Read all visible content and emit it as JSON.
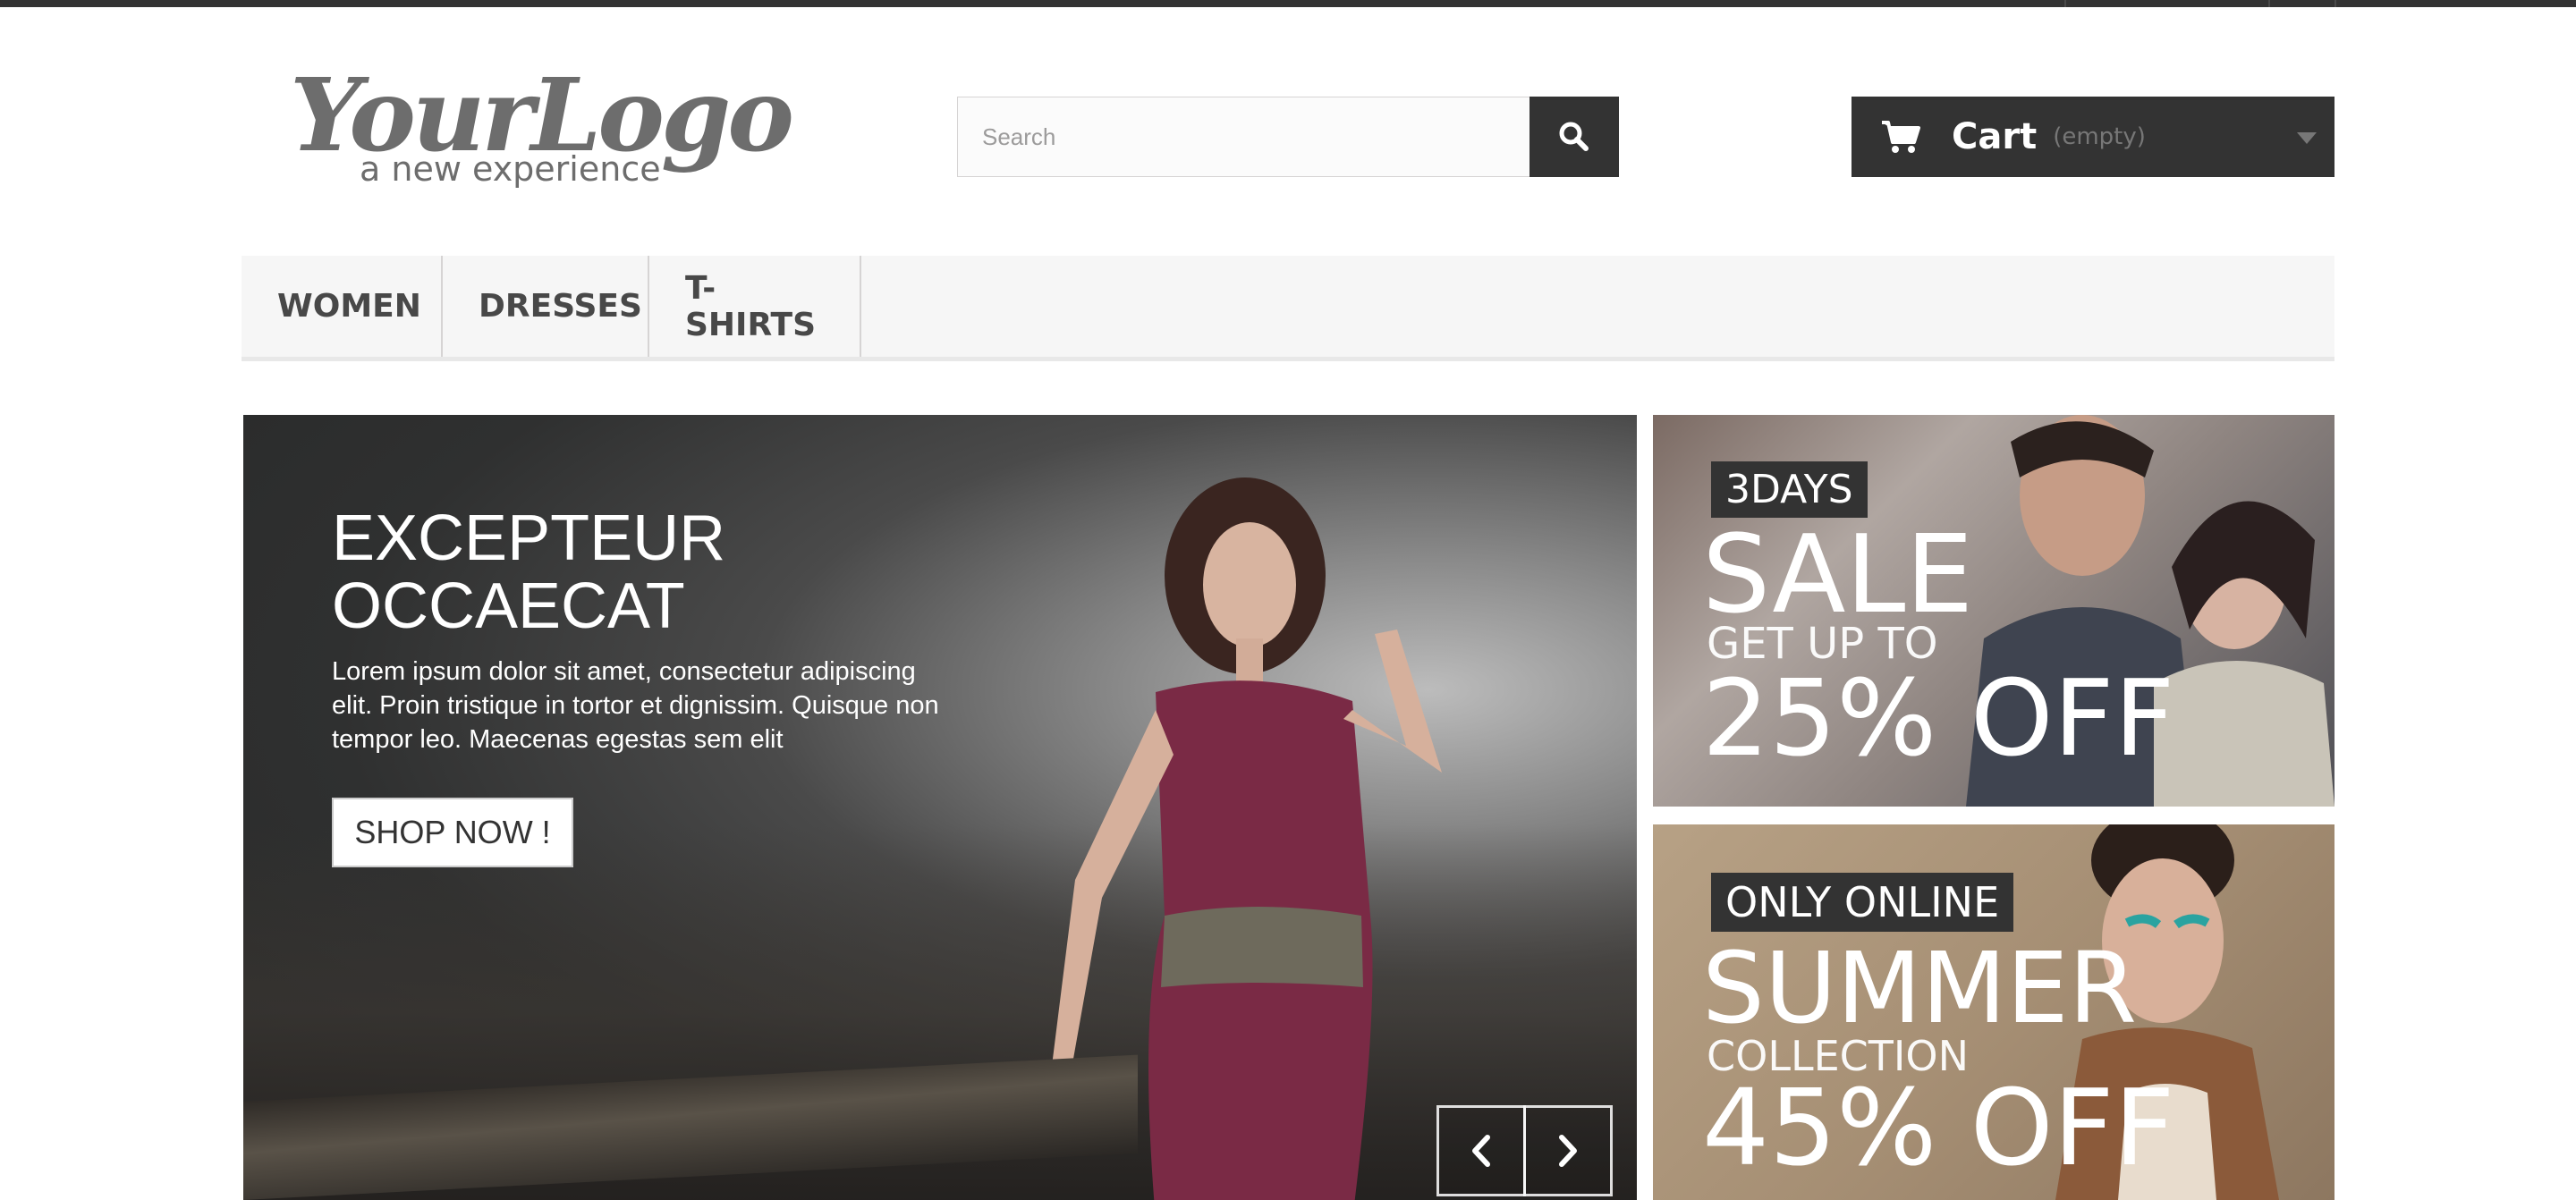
{
  "logo": {
    "main": "YourLogo",
    "tagline": "a new experience"
  },
  "search": {
    "placeholder": "Search"
  },
  "cart": {
    "label": "Cart",
    "state": "(empty)"
  },
  "menu": {
    "items": [
      {
        "label": "WOMEN"
      },
      {
        "label": "DRESSES"
      },
      {
        "label": "T-SHIRTS"
      }
    ]
  },
  "slider": {
    "title": "EXCEPTEUR OCCAECAT",
    "description": "Lorem ipsum dolor sit amet, consectetur adipiscing elit. Proin tristique in tortor et dignissim. Quisque non tempor leo. Maecenas egestas sem elit",
    "button": "SHOP NOW !"
  },
  "banners": [
    {
      "tag": "3DAYS",
      "headline": "SALE",
      "subline": "GET UP TO",
      "offer": "25% OFF"
    },
    {
      "tag": "ONLY ONLINE",
      "headline": "SUMMER",
      "subline": "COLLECTION",
      "offer": "45% OFF"
    }
  ],
  "colors": {
    "dark": "#333333",
    "menu_bg": "#f6f6f6",
    "border": "#d6d4d4"
  }
}
